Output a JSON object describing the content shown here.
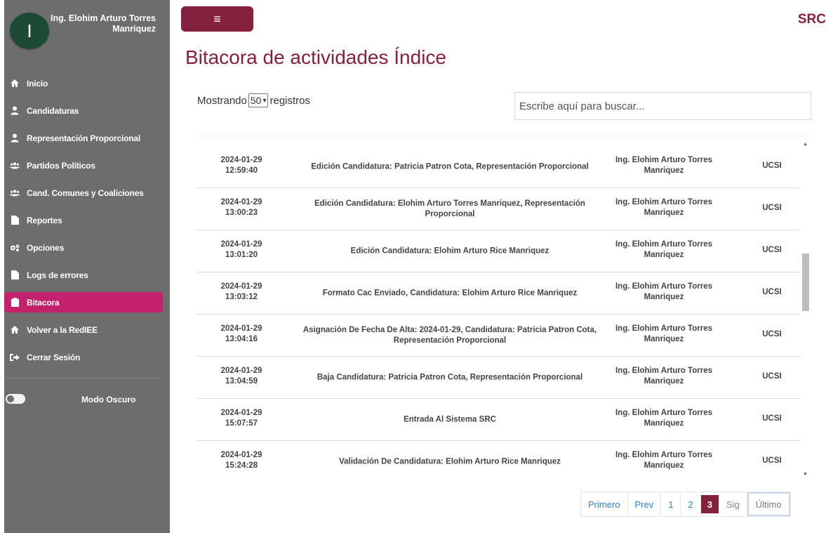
{
  "user": {
    "initial": "I",
    "name": "Ing. Elohim Arturo Torres Manriquez"
  },
  "sidebar": {
    "items": [
      {
        "label": "Inicio",
        "icon": "home-icon"
      },
      {
        "label": "Candidaturas",
        "icon": "user-icon"
      },
      {
        "label": "Representación Proporcional",
        "icon": "user-icon"
      },
      {
        "label": "Partidos Políticos",
        "icon": "users-icon"
      },
      {
        "label": "Cand. Comunes y Coaliciones",
        "icon": "users-icon"
      },
      {
        "label": "Reportes",
        "icon": "file-icon"
      },
      {
        "label": "Opciones",
        "icon": "gears-icon"
      },
      {
        "label": "Logs de errores",
        "icon": "file-icon"
      },
      {
        "label": "Bitacora",
        "icon": "clipboard-icon",
        "active": true
      },
      {
        "label": "Volver a la RedIEE",
        "icon": "home-icon"
      },
      {
        "label": "Cerrar Sesión",
        "icon": "sign-out-icon"
      }
    ],
    "dark_mode_label": "Modo Oscuro"
  },
  "header": {
    "menu_icon": "≡",
    "brand": "SRC"
  },
  "page": {
    "title": "Bitacora de actividades Índice",
    "length": {
      "prefix": "Mostrando",
      "value": "50",
      "suffix": "registros"
    },
    "search_placeholder": "Escribe aquí para buscar..."
  },
  "rows": [
    {
      "date": "2024-01-29",
      "time": "12:59:40",
      "desc": "Edición Candidatura: Patricia Patron Cota, Representación Proporcional",
      "user": "Ing. Elohim Arturo Torres Manriquez",
      "area": "UCSI"
    },
    {
      "date": "2024-01-29",
      "time": "13:00:23",
      "desc": "Edición Candidatura: Elohim Arturo Torres Manriquez, Representación Proporcional",
      "user": "Ing. Elohim Arturo Torres Manriquez",
      "area": "UCSI"
    },
    {
      "date": "2024-01-29",
      "time": "13:01:20",
      "desc": "Edición Candidatura: Elohim Arturo Rice Manriquez",
      "user": "Ing. Elohim Arturo Torres Manriquez",
      "area": "UCSI"
    },
    {
      "date": "2024-01-29",
      "time": "13:03:12",
      "desc": "Formato Cac Enviado, Candidatura: Elohim Arturo Rice Manriquez",
      "user": "Ing. Elohim Arturo Torres Manriquez",
      "area": "UCSI"
    },
    {
      "date": "2024-01-29",
      "time": "13:04:16",
      "desc": "Asignación De Fecha De Alta: 2024-01-29, Candidatura: Patricia Patron Cota, Representación Proporcional",
      "user": "Ing. Elohim Arturo Torres Manriquez",
      "area": "UCSI"
    },
    {
      "date": "2024-01-29",
      "time": "13:04:59",
      "desc": "Baja Candidatura: Patricia Patron Cota, Representación Proporcional",
      "user": "Ing. Elohim Arturo Torres Manriquez",
      "area": "UCSI"
    },
    {
      "date": "2024-01-29",
      "time": "15:07:57",
      "desc": "Entrada Al Sistema SRC",
      "user": "Ing. Elohim Arturo Torres Manriquez",
      "area": "UCSI"
    },
    {
      "date": "2024-01-29",
      "time": "15:24:28",
      "desc": "Validación De Candidatura: Elohim Arturo Rice Manriquez",
      "user": "Ing. Elohim Arturo Torres Manriquez",
      "area": "UCSI"
    }
  ],
  "pagination": {
    "first": "Primero",
    "prev": "Prev",
    "pages": [
      "1",
      "2",
      "3"
    ],
    "current": "3",
    "next": "Sig",
    "last": "Último"
  },
  "colors": {
    "primary": "#84213f",
    "active_nav": "#c4216c",
    "sidebar": "#6d6d6d",
    "avatar": "#1d4a37",
    "link": "#2f7fd8"
  }
}
